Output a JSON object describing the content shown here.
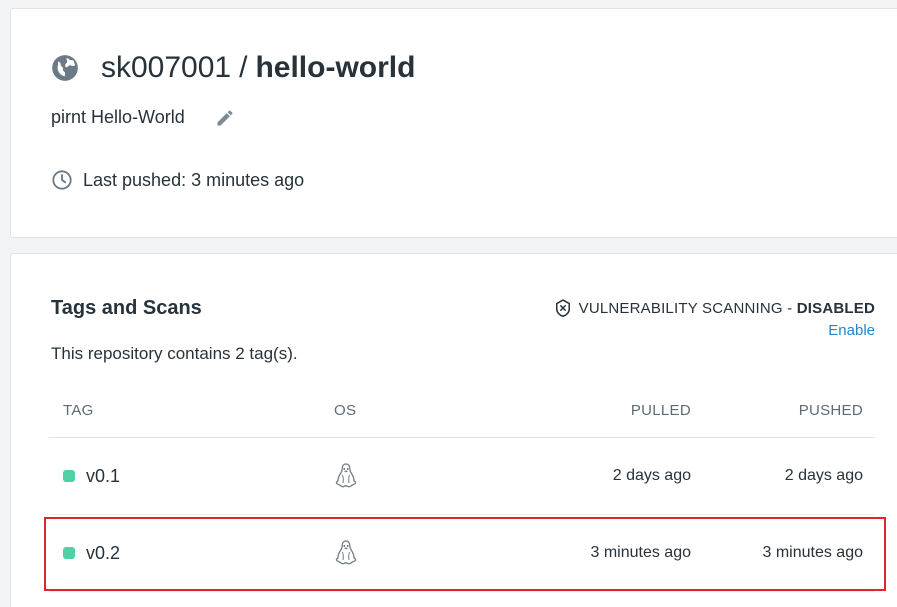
{
  "repo": {
    "owner": "sk007001",
    "separator": "/",
    "name": "hello-world",
    "description": "pirnt Hello-World",
    "last_pushed": "Last pushed: 3 minutes ago"
  },
  "tags_section": {
    "heading": "Tags and Scans",
    "vuln_label": "VULNERABILITY SCANNING - ",
    "vuln_status": "DISABLED",
    "enable_label": "Enable",
    "tag_count": "This repository contains 2 tag(s).",
    "columns": {
      "tag": "TAG",
      "os": "OS",
      "pulled": "PULLED",
      "pushed": "PUSHED"
    },
    "rows": [
      {
        "tag": "v0.1",
        "os_icon": "linux-icon",
        "pulled": "2 days ago",
        "pushed": "2 days ago"
      },
      {
        "tag": "v0.2",
        "os_icon": "linux-icon",
        "pulled": "3 minutes ago",
        "pushed": "3 minutes ago"
      }
    ]
  },
  "colors": {
    "tag_dot": "#4fd1a5",
    "link": "#1e87cf",
    "highlight_border": "#e0252c"
  }
}
